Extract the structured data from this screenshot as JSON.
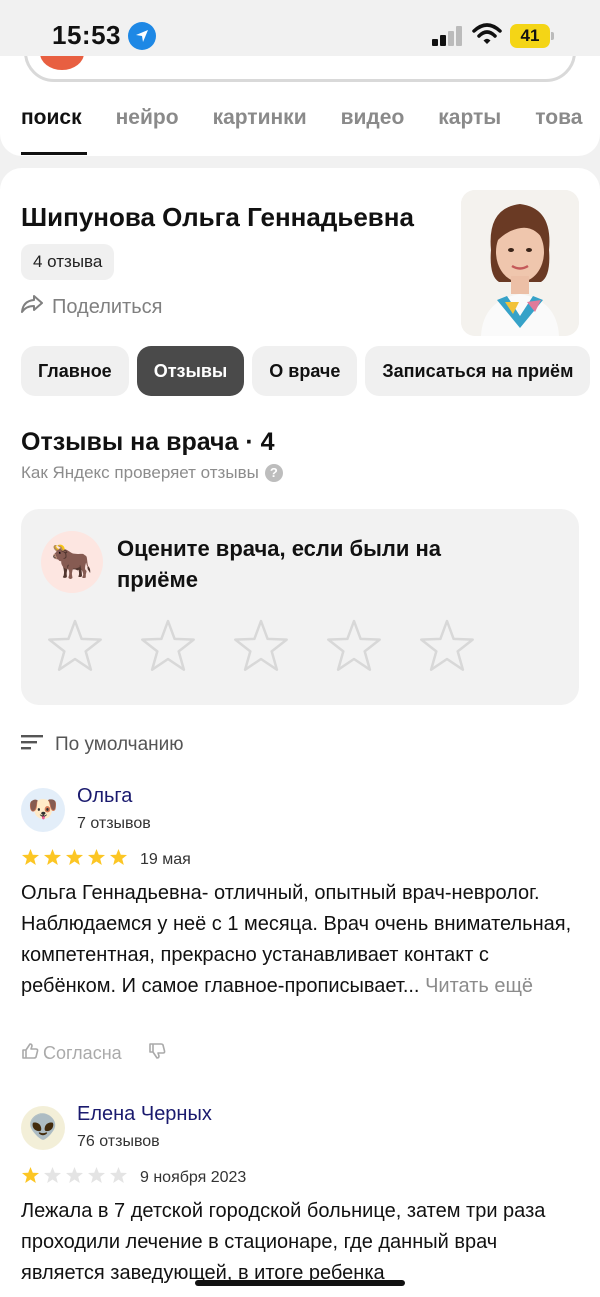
{
  "status_bar": {
    "time": "15:53",
    "battery": "41"
  },
  "tabs": [
    "поиск",
    "нейро",
    "картинки",
    "видео",
    "карты",
    "това"
  ],
  "doctor": {
    "name": "Шипунова Ольга Геннадьевна",
    "reviews_count": "4 отзыва",
    "share_label": "Поделиться"
  },
  "section_tabs": [
    "Главное",
    "Отзывы",
    "О враче",
    "Записаться на приём"
  ],
  "reviews_section": {
    "title": "Отзывы на врача · 4",
    "subtitle": "Как Яндекс проверяет отзывы",
    "rate_prompt": "Оцените врача, если были на приёме",
    "sort_label": "По умолчанию"
  },
  "reviews": [
    {
      "author": "Ольга",
      "count": "7 отзывов",
      "rating": 5,
      "date": "19 мая",
      "text": "Ольга Геннадьевна- отличный, опытный врач-невролог. Наблюдаемся у неё с 1 месяца. Врач очень внимательная, компетентная, прекрасно устанавливает контакт с ребёнком. И самое главное-прописывает...",
      "more": "Читать ещё",
      "agree": "Согласна"
    },
    {
      "author": "Елена Черных",
      "count": "76 отзывов",
      "rating": 1,
      "date": "9 ноября 2023",
      "text": "Лежала в 7 детской городской больнице, затем три раза проходили лечение в стационаре, где данный врач является заведующей, в итоге ребенка"
    }
  ],
  "colors": {
    "star": "#fcc624",
    "star_empty": "#d8d8d8",
    "active_pill": "#4a4a4a",
    "author": "#1a1a6e"
  },
  "icons": [
    "location-arrow-icon",
    "signal-icon",
    "wifi-icon",
    "battery-icon",
    "share-icon",
    "question-icon",
    "yak-icon",
    "sort-icon",
    "dog-avatar-icon",
    "alien-avatar-icon",
    "thumb-up-icon",
    "thumb-down-icon"
  ]
}
